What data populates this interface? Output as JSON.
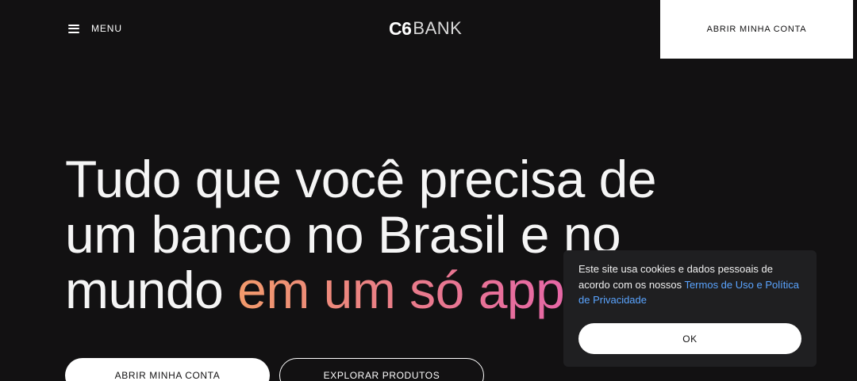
{
  "header": {
    "menu_label": "MENU",
    "logo_mark": "C6",
    "logo_word": "BANK",
    "cta_label": "ABRIR MINHA CONTA"
  },
  "hero": {
    "line1": "Tudo que você precisa de",
    "line2": "um banco no Brasil e no",
    "line3_plain": "mundo ",
    "line3_highlight": "em um só app"
  },
  "actions": {
    "primary_label": "ABRIR MINHA CONTA",
    "secondary_label": "EXPLORAR PRODUTOS"
  },
  "cookie_banner": {
    "text_before": "Este site usa cookies e dados pessoais de acordo com os nossos ",
    "terms_link": "Termos de Uso",
    "connector": " e ",
    "privacy_link": "Política de Privacidade",
    "ok_label": "OK"
  },
  "colors": {
    "background": "#121112",
    "surface": "#1f1f21",
    "link": "#5aa4ff",
    "gradient_start": "#f29a6b",
    "gradient_end": "#e667a6"
  },
  "icons": {
    "menu": "hamburger-icon"
  }
}
